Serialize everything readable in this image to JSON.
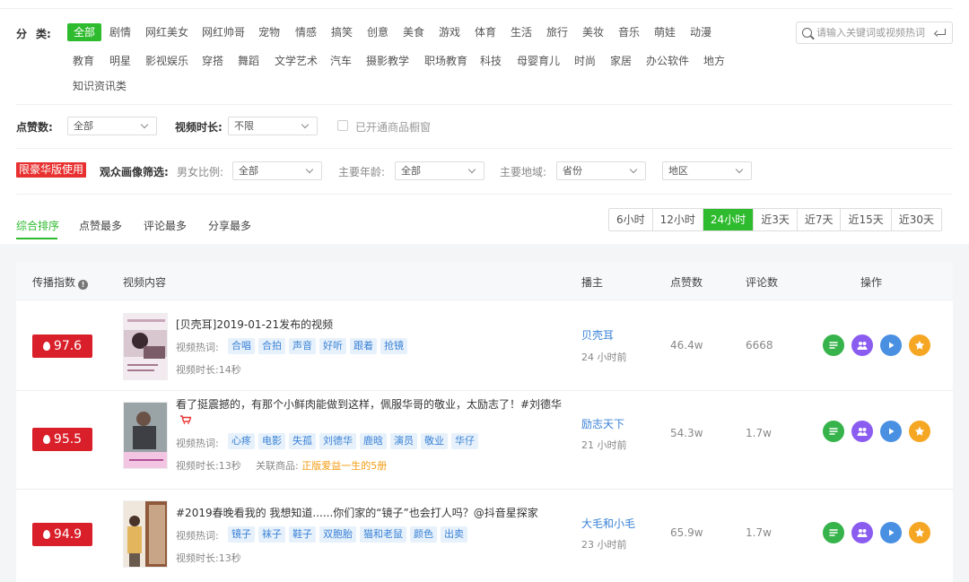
{
  "categories": {
    "label_a": "分",
    "label_b": "类:",
    "items": [
      "全部",
      "剧情",
      "网红美女",
      "网红帅哥",
      "宠物",
      "情感",
      "搞笑",
      "创意",
      "美食",
      "游戏",
      "体育",
      "生活",
      "旅行",
      "美妆",
      "音乐",
      "萌娃",
      "动漫",
      "教育",
      "明星",
      "影视娱乐",
      "穿搭",
      "舞蹈",
      "文学艺术",
      "汽车",
      "摄影教学",
      "职场教育",
      "科技",
      "母婴育儿",
      "时尚",
      "家居",
      "办公软件",
      "地方",
      "知识资讯类"
    ],
    "active_index": 0
  },
  "search": {
    "placeholder": "请输入关键词或视频热词"
  },
  "filters": {
    "likes_label": "点赞数:",
    "likes_value": "全部",
    "duration_label": "视频时长:",
    "duration_value": "不限",
    "shop_checkbox_label": "已开通商品橱窗"
  },
  "audience": {
    "vip_badge": "限豪华版使用",
    "label": "观众画像筛选:",
    "gender_label": "男女比例:",
    "gender_value": "全部",
    "age_label": "主要年龄:",
    "age_value": "全部",
    "region_label": "主要地域:",
    "province_value": "省份",
    "area_value": "地区"
  },
  "sort_tabs": [
    "综合排序",
    "点赞最多",
    "评论最多",
    "分享最多"
  ],
  "time_ranges": [
    "6小时",
    "12小时",
    "24小时",
    "近3天",
    "近7天",
    "近15天",
    "近30天"
  ],
  "time_active_index": 2,
  "table": {
    "headers": {
      "score": "传播指数",
      "content": "视频内容",
      "author": "播主",
      "likes": "点赞数",
      "comments": "评论数",
      "ops": "操作"
    },
    "hot_label": "视频热词:",
    "duration_prefix": "视频时长:",
    "product_prefix": "关联商品:",
    "rows": [
      {
        "score": "97.6",
        "title": "[贝壳耳]2019-01-21发布的视频",
        "tags": [
          "合唱",
          "合拍",
          "声音",
          "好听",
          "跟着",
          "抢镜"
        ],
        "duration": "14秒",
        "author": "贝壳耳",
        "ago": "24 小时前",
        "likes": "46.4w",
        "comments": "6668"
      },
      {
        "score": "95.5",
        "title": "看了挺震撼的，有那个小鲜肉能做到这样，佩服华哥的敬业，太励志了！#刘德华",
        "tags": [
          "心疼",
          "电影",
          "失孤",
          "刘德华",
          "鹿晗",
          "演员",
          "敬业",
          "华仔"
        ],
        "duration": "13秒",
        "product": "正版爱益一生的5册",
        "author": "励志天下",
        "ago": "21 小时前",
        "likes": "54.3w",
        "comments": "1.7w"
      },
      {
        "score": "94.9",
        "title": "#2019春晚看我的 我想知道......你们家的“镜子”也会打人吗？@抖音星探家",
        "tags": [
          "镜子",
          "袜子",
          "鞋子",
          "双胞胎",
          "猫和老鼠",
          "颜色",
          "出卖"
        ],
        "duration": "13秒",
        "author": "大毛和小毛",
        "ago": "23 小时前",
        "likes": "65.9w",
        "comments": "1.7w"
      }
    ]
  },
  "colors": {
    "accent": "#2ebb2e",
    "danger": "#d9202a",
    "link": "#3a82d6",
    "product": "#f39c12"
  }
}
